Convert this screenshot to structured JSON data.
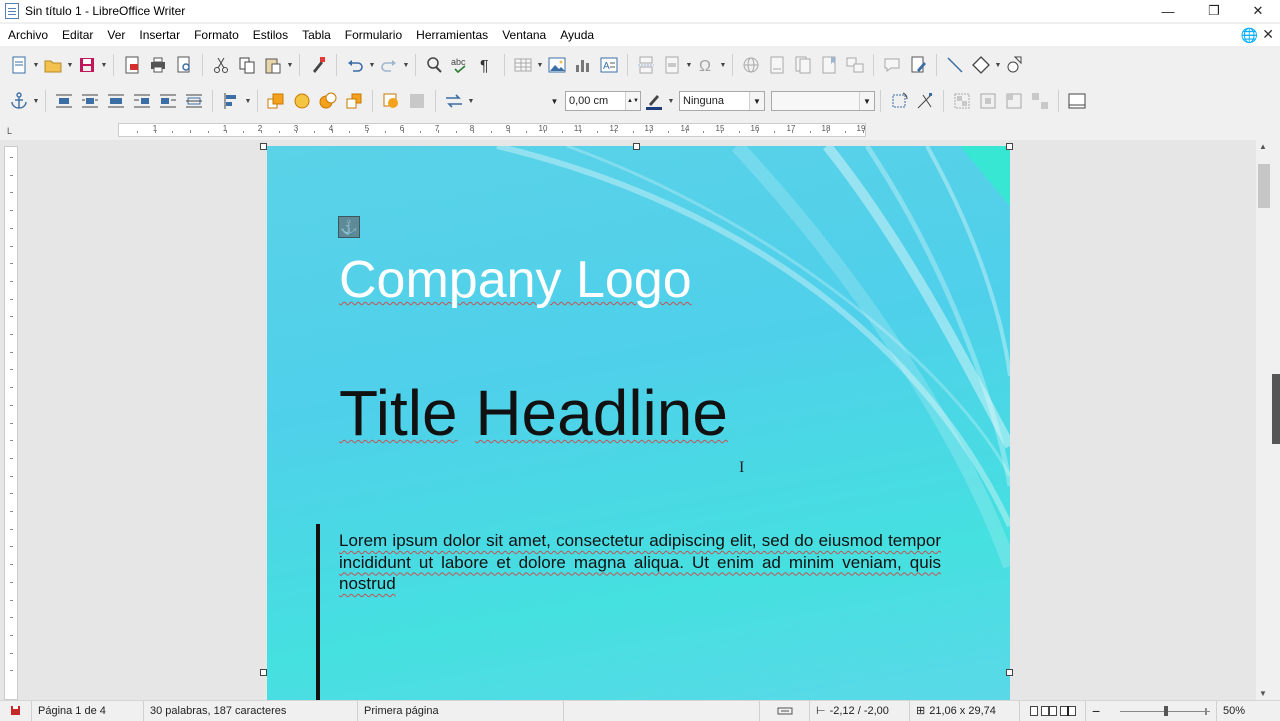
{
  "window": {
    "title": "Sin título 1 - LibreOffice Writer",
    "minimize": "—",
    "restore": "❐",
    "close": "✕"
  },
  "menu": {
    "items": [
      "Archivo",
      "Editar",
      "Ver",
      "Insertar",
      "Formato",
      "Estilos",
      "Tabla",
      "Formulario",
      "Herramientas",
      "Ventana",
      "Ayuda"
    ],
    "close_doc": "✕"
  },
  "toolbar2": {
    "line_width": "0,00 cm",
    "area_style": "Ninguna",
    "area_fill": ""
  },
  "ruler": {
    "numbers": [
      "1",
      "1",
      "2",
      "3",
      "4",
      "5",
      "6",
      "7",
      "8",
      "9",
      "10",
      "11",
      "12",
      "13",
      "14",
      "15",
      "16",
      "17",
      "18",
      "19",
      "20"
    ]
  },
  "document": {
    "logo_text": "Company Logo",
    "headline_word1": "Title",
    "headline_word2": "Headline",
    "body_text": "Lorem ipsum dolor sit amet, consectetur adipiscing elit, sed do eiusmod tempor incididunt ut labore et dolore magna aliqua. Ut enim ad minim veniam, quis nostrud"
  },
  "status": {
    "page": "Página 1 de 4",
    "words": "30 palabras, 187 caracteres",
    "page_style": "Primera página",
    "position": "-2,12 / -2,00",
    "size": "21,06 x 29,74",
    "zoom": "50%"
  },
  "colors": {
    "page_gradient_start": "#5ad2e8",
    "page_gradient_end": "#45e0e0",
    "logo_text": "#ffffff",
    "headline_text": "#111111"
  }
}
